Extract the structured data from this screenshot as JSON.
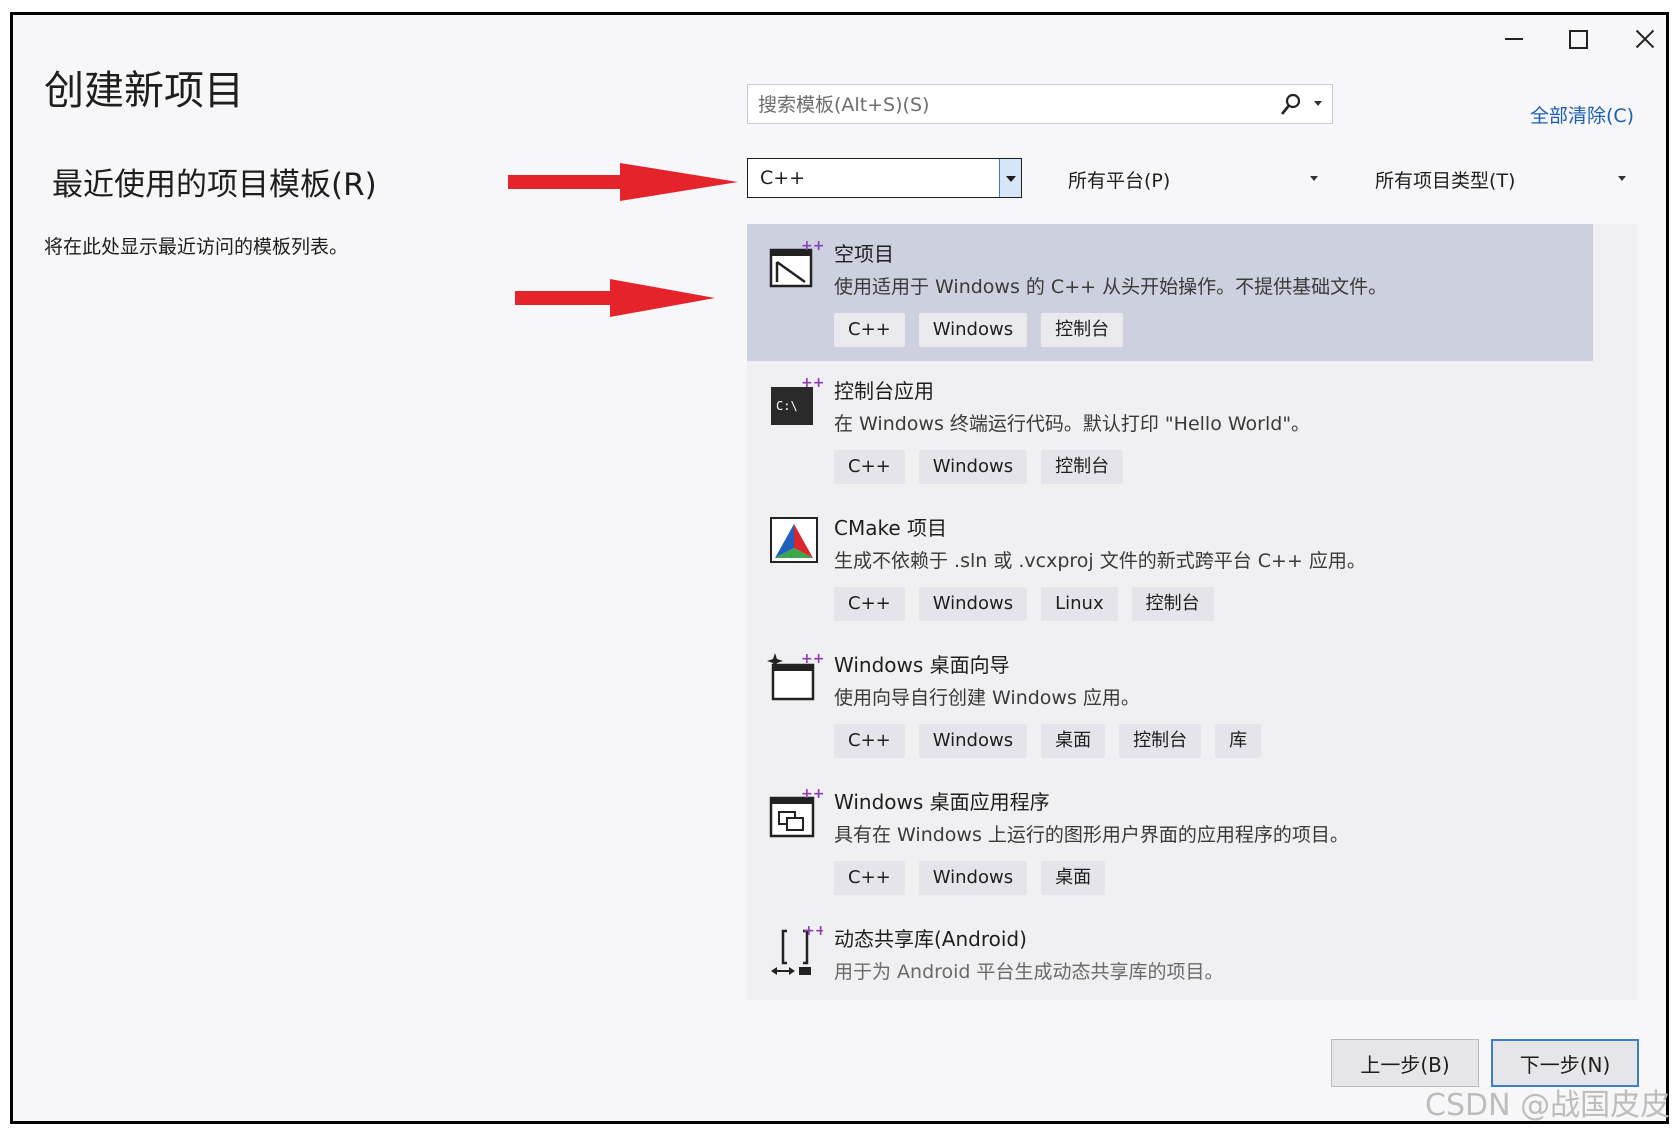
{
  "window": {
    "title": "创建新项目",
    "controls": [
      "minimize",
      "maximize",
      "close"
    ]
  },
  "left": {
    "recent_heading": "最近使用的项目模板(R)",
    "recent_empty": "将在此处显示最近访问的模板列表。"
  },
  "search": {
    "placeholder": "搜索模板(Alt+S)(S)",
    "value": ""
  },
  "clear_all": "全部清除(C)",
  "filters": {
    "language": "C++",
    "platform": "所有平台(P)",
    "project_type": "所有项目类型(T)"
  },
  "templates": [
    {
      "name": "空项目",
      "desc": "使用适用于 Windows 的 C++ 从头开始操作。不提供基础文件。",
      "tags": [
        "C++",
        "Windows",
        "控制台"
      ],
      "icon": "empty-project-icon",
      "selected": true
    },
    {
      "name": "控制台应用",
      "desc": "在 Windows 终端运行代码。默认打印 \"Hello World\"。",
      "tags": [
        "C++",
        "Windows",
        "控制台"
      ],
      "icon": "console-app-icon",
      "selected": false
    },
    {
      "name": "CMake 项目",
      "desc": "生成不依赖于 .sln 或 .vcxproj 文件的新式跨平台 C++ 应用。",
      "tags": [
        "C++",
        "Windows",
        "Linux",
        "控制台"
      ],
      "icon": "cmake-icon",
      "selected": false
    },
    {
      "name": "Windows 桌面向导",
      "desc": "使用向导自行创建 Windows 应用。",
      "tags": [
        "C++",
        "Windows",
        "桌面",
        "控制台",
        "库"
      ],
      "icon": "desktop-wizard-icon",
      "selected": false
    },
    {
      "name": "Windows 桌面应用程序",
      "desc": "具有在 Windows 上运行的图形用户界面的应用程序的项目。",
      "tags": [
        "C++",
        "Windows",
        "桌面"
      ],
      "icon": "desktop-app-icon",
      "selected": false
    },
    {
      "name": "动态共享库(Android)",
      "desc": "用于为 Android 平台生成动态共享库的项目。",
      "tags": [],
      "icon": "android-shared-lib-icon",
      "selected": false
    }
  ],
  "buttons": {
    "back": "上一步(B)",
    "next": "下一步(N)"
  },
  "watermark": "CSDN @战国皮皮",
  "colors": {
    "accent": "#3c7fc7",
    "link": "#1a5fb4",
    "selected_row": "#cdd0de",
    "arrow": "#e5232a"
  }
}
